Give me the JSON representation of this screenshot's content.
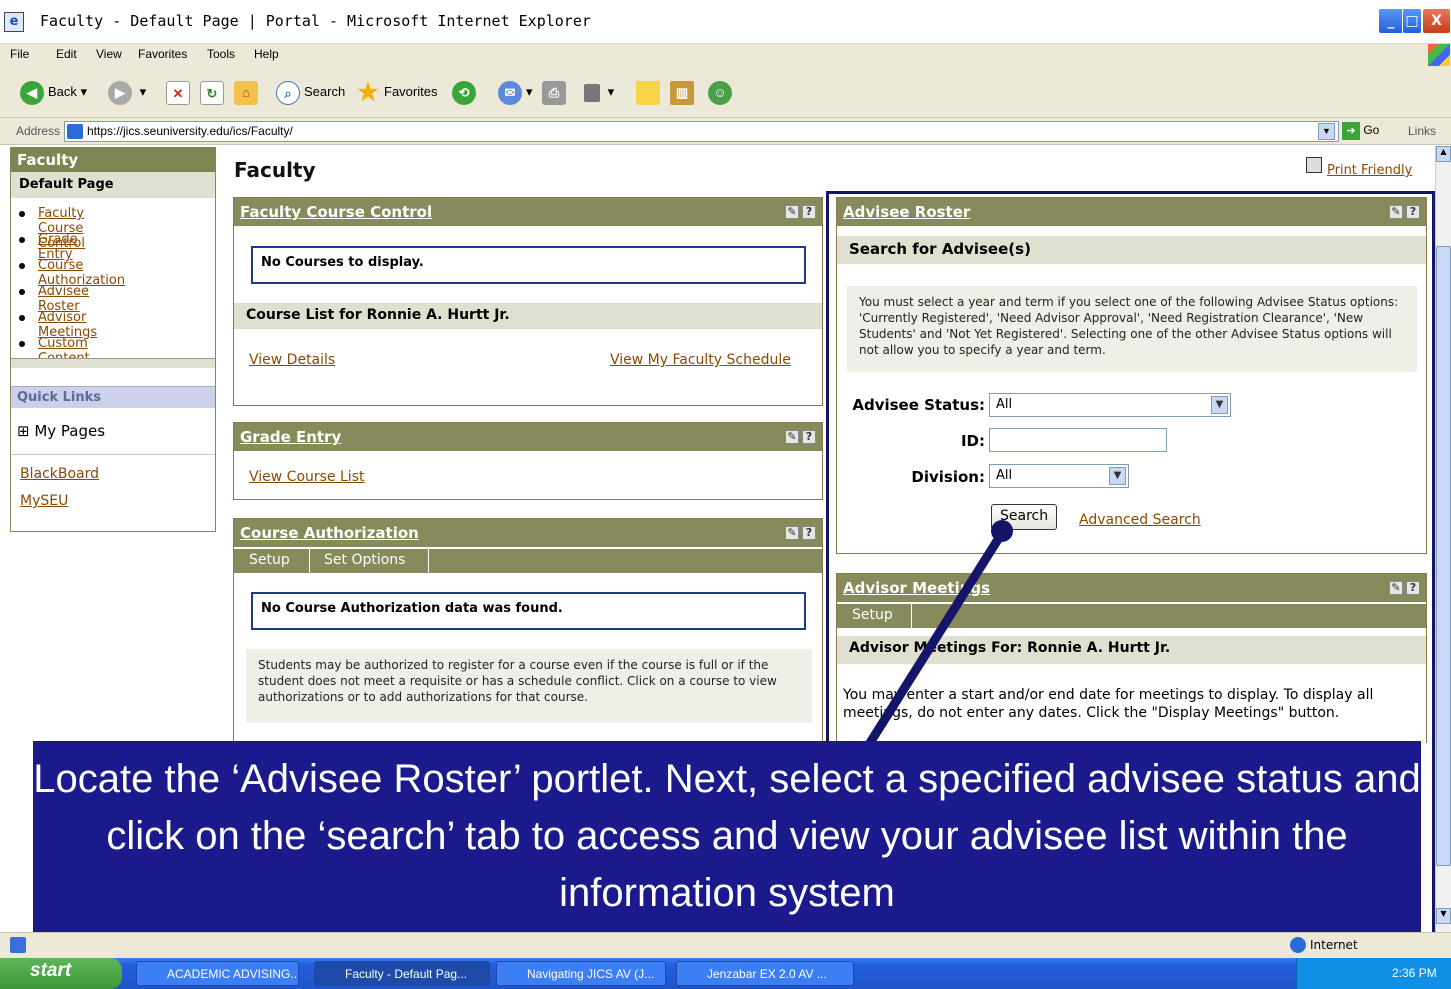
{
  "window": {
    "title": "Faculty - Default Page | Portal - Microsoft Internet Explorer",
    "min": "_",
    "max": "□",
    "close": "X"
  },
  "menu": [
    "File",
    "Edit",
    "View",
    "Favorites",
    "Tools",
    "Help"
  ],
  "toolbar": {
    "back": "Back",
    "search": "Search",
    "favorites": "Favorites"
  },
  "address": {
    "label": "Address",
    "url": "https://jics.seuniversity.edu/ics/Faculty/",
    "go": "Go",
    "links": "Links"
  },
  "leftnav": {
    "header": "Faculty",
    "sub": "Default Page",
    "items": [
      "Faculty Course Control",
      "Grade Entry",
      "Course Authorization",
      "Advisee Roster",
      "Advisor Meetings",
      "Custom Content"
    ],
    "quick_links": "Quick Links",
    "my_pages": "⊞ My Pages",
    "links": [
      "BlackBoard",
      "MySEU"
    ]
  },
  "main": {
    "title": "Faculty",
    "print_friendly": "Print Friendly"
  },
  "fcc": {
    "title": "Faculty Course Control",
    "no_courses": "No Courses to display.",
    "course_list": "Course List for Ronnie A. Hurtt Jr.",
    "view_details": "View Details",
    "view_schedule": "View My Faculty Schedule"
  },
  "grade": {
    "title": "Grade Entry",
    "view_list": "View Course List"
  },
  "ca": {
    "title": "Course Authorization",
    "tab_setup": "Setup",
    "tab_options": "Set Options",
    "no_data": "No Course Authorization data was found.",
    "info": "Students may be authorized to register for a course even if the course is full or if the student does not meet a requisite or has a schedule conflict. Click on a course to view authorizations or to add authorizations for that course."
  },
  "roster": {
    "title": "Advisee Roster",
    "search_for": "Search for Advisee(s)",
    "info": "You must select a year and term if you select one of the following Advisee Status options: 'Currently Registered', 'Need Advisor Approval', 'Need Registration Clearance', 'New Students' and 'Not Yet Registered'. Selecting one of the other Advisee Status options will not allow you to specify a year and term.",
    "status_label": "Advisee Status:",
    "status_value": "All",
    "id_label": "ID:",
    "division_label": "Division:",
    "division_value": "All",
    "search_btn": "Search",
    "advanced": "Advanced Search"
  },
  "meetings": {
    "title": "Advisor Meetings",
    "tab_setup": "Setup",
    "for": "Advisor Meetings For: Ronnie A. Hurtt Jr.",
    "info": "You may enter a start and/or end date for meetings to display. To display all meetings, do not enter any dates. Click the \"Display Meetings\" button."
  },
  "callout": "Locate the ‘Advisee Roster’ portlet. Next, select a specified advisee status and click on the ‘search’ tab to access and view your advisee list within the information system",
  "status": {
    "zone": "Internet"
  },
  "taskbar": {
    "start": "start",
    "tasks": [
      "ACADEMIC ADVISING...",
      "Faculty - Default Pag...",
      "Navigating JICS AV (J...",
      "Jenzabar EX 2.0 AV ..."
    ],
    "clock": "2:36 PM"
  },
  "icon_button": "?",
  "colors": {
    "portlet_header": "#878a5a",
    "link": "#8a4a00",
    "callout": "#1a1a8c",
    "highlight": "#141468"
  }
}
